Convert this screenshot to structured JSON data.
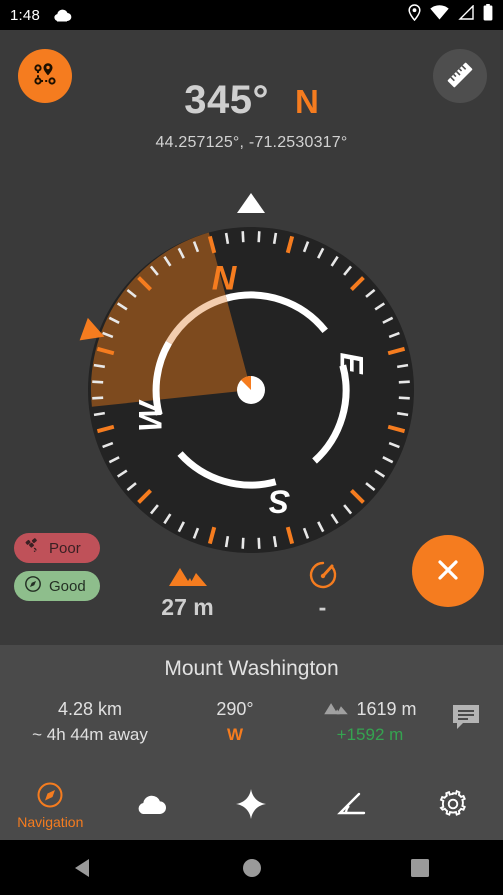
{
  "statusbar": {
    "time": "1:48",
    "icons": [
      "cloud-icon",
      "location-pin-icon",
      "wifi-icon",
      "cell-signal-icon",
      "battery-icon"
    ]
  },
  "header": {
    "route_button": "route-waypoints-icon",
    "ruler_button": "ruler-icon",
    "heading_degrees": "345°",
    "heading_cardinal": "N",
    "coordinates": "44.257125°,  -71.2530317°"
  },
  "compass": {
    "heading": 345,
    "dial_rotation_deg": -15,
    "cardinals": {
      "n": "N",
      "e": "E",
      "s": "S",
      "w": "W"
    },
    "sector": {
      "start_deg": 255,
      "end_deg": 360,
      "color": "#7d4a1e"
    },
    "target_bearing_deg": 290,
    "marker_color": "#f57c1f",
    "sun": "sun-icon",
    "moon": "moon-icon"
  },
  "badges": [
    {
      "label": "Poor",
      "icon": "satellite-icon",
      "color": "#bf5159"
    },
    {
      "label": "Good",
      "icon": "compass-icon",
      "color": "#8ebe8c"
    }
  ],
  "metrics": [
    {
      "icon": "mountain-icon",
      "value": "27 m"
    },
    {
      "icon": "speedometer-icon",
      "value": "-"
    }
  ],
  "fab": {
    "icon": "close-icon",
    "color": "#f57c1f"
  },
  "target": {
    "name": "Mount Washington",
    "distance": "4.28 km",
    "eta": "~ 4h 44m away",
    "bearing": "290°",
    "bearing_cardinal": "W",
    "elevation": "1619 m",
    "elevation_gain": "+1592 m",
    "elevation_gain_color": "#35a350",
    "note_button": "note-icon"
  },
  "bottomnav": {
    "items": [
      {
        "id": "navigation",
        "icon": "compass-icon",
        "label": "Navigation",
        "active": true
      },
      {
        "id": "weather",
        "icon": "cloud-icon",
        "label": "",
        "active": false
      },
      {
        "id": "sky",
        "icon": "star-icon",
        "label": "",
        "active": false
      },
      {
        "id": "angle",
        "icon": "angle-icon",
        "label": "",
        "active": false
      },
      {
        "id": "settings",
        "icon": "gear-icon",
        "label": "",
        "active": false
      }
    ]
  },
  "androidnav": {
    "back": "back-icon",
    "home": "home-icon",
    "recents": "recents-icon"
  }
}
